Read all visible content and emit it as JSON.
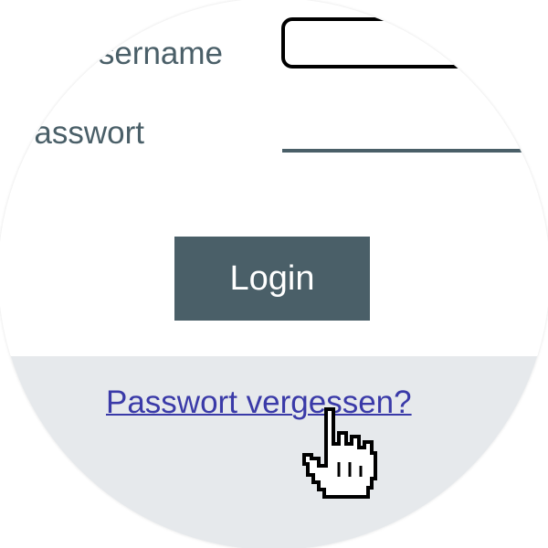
{
  "form": {
    "username_label": "Username",
    "username_value": "",
    "password_label": "Passwort",
    "password_value": "",
    "login_button_label": "Login",
    "forgot_password_link": "Passwort vergessen?"
  },
  "colors": {
    "label": "#4a5f68",
    "button_background": "#4a5f68",
    "button_text": "#ffffff",
    "link": "#3a3aa8",
    "lower_band": "#e6e9ec"
  },
  "icons": {
    "cursor": "hand-pointer-icon"
  }
}
